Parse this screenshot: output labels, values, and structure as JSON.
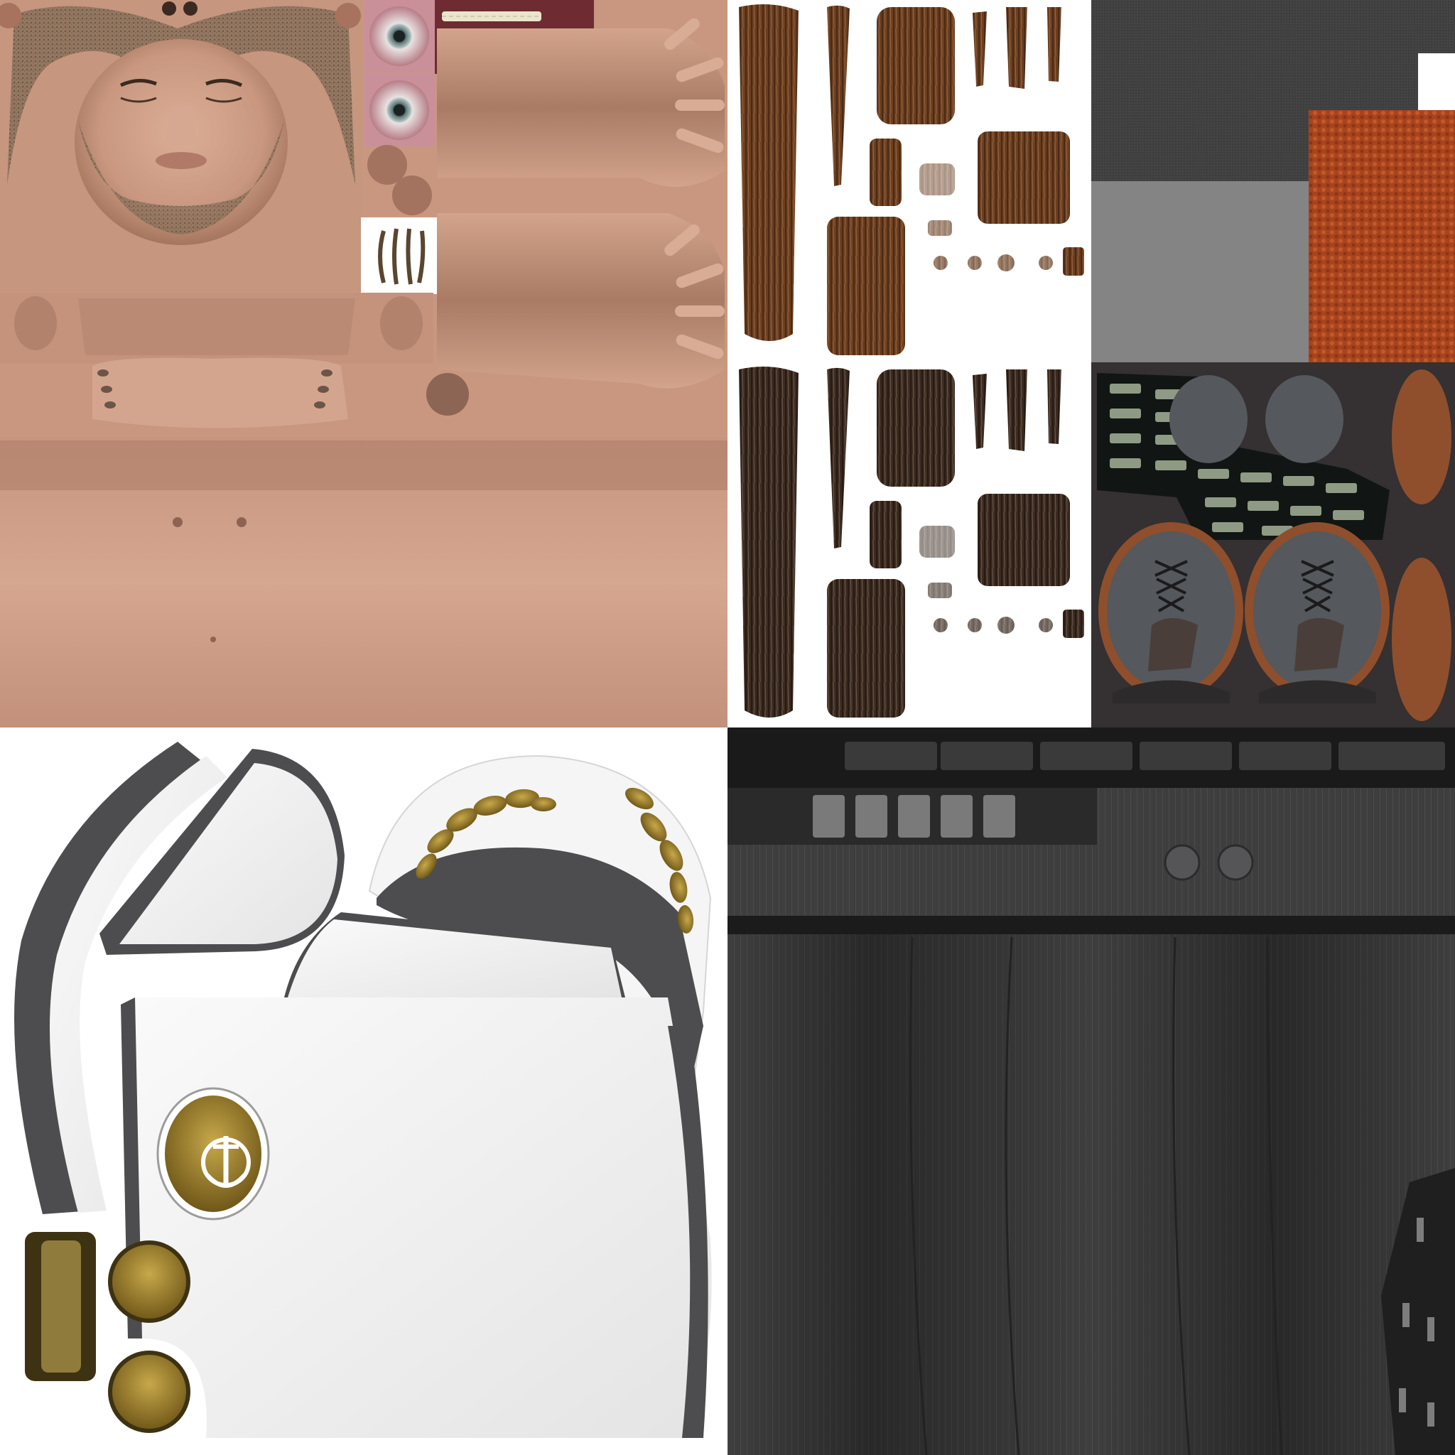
{
  "atlas": {
    "kind": "texture-atlas",
    "quadrants": [
      "skin",
      "hair",
      "clothing-and-shoes",
      "captain-uniform",
      "trousers"
    ]
  },
  "colors": {
    "skin_base": "#c9977f",
    "skin_shadow": "#9c6f5c",
    "skin_light": "#dcae96",
    "stubble": "#7a6450",
    "hair_brown": "#6b3e1f",
    "hair_dark": "#3b2a1f",
    "hair_bg": "#ffffff",
    "cloth_dark_gray": "#3f3f40",
    "cloth_mid_gray": "#848484",
    "cloth_orange": "#a8431d",
    "shoe_bg": "#353031",
    "shoe_gray": "#55585c",
    "shoe_sole": "#8f4f2c",
    "patch_green": "#8f9a84",
    "uniform_white": "#f2f2f2",
    "uniform_shadow": "#4d4d4f",
    "gold": "#a2842a",
    "trouser_gray": "#3e3e3f",
    "trouser_dark": "#1a1a1b"
  },
  "icons": {
    "eyeball": "eye-icon",
    "teeth": "teeth-icon",
    "anchor_emblem": "anchor-icon",
    "oak_leaf": "oak-leaf-icon",
    "shoe_top": "shoe-icon",
    "button": "button-icon"
  }
}
